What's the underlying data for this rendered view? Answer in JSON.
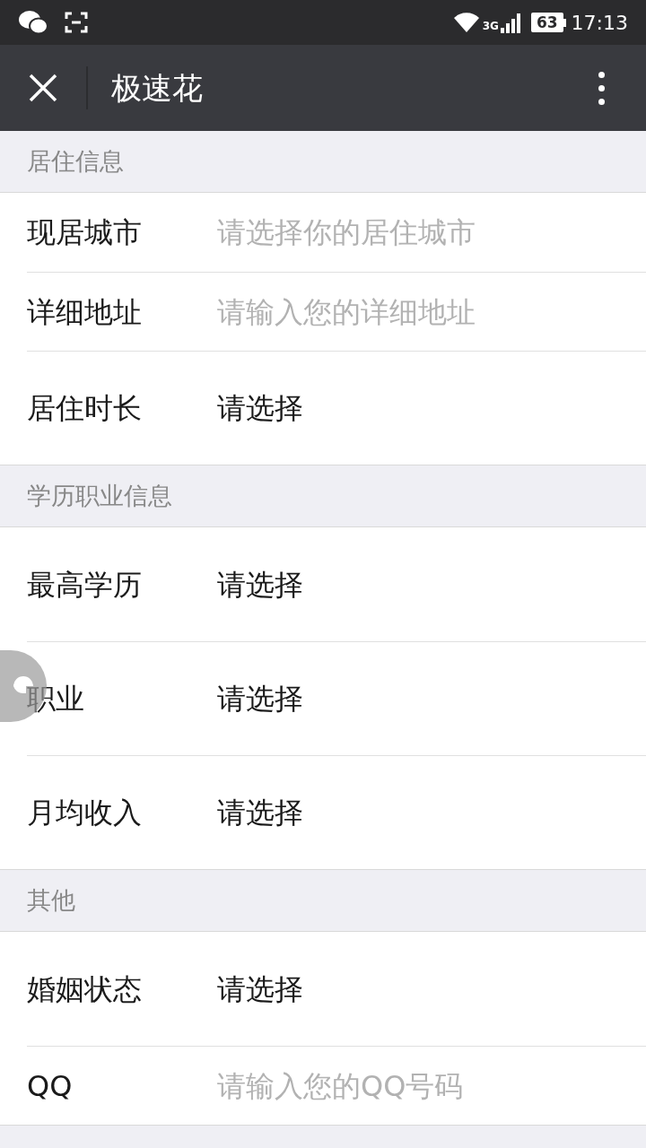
{
  "status_bar": {
    "network": "3G",
    "battery": "63",
    "time": "17:13"
  },
  "nav": {
    "title": "极速花"
  },
  "sections": [
    {
      "title": "居住信息",
      "rows": [
        {
          "label": "现居城市",
          "placeholder": "请选择你的居住城市"
        },
        {
          "label": "详细地址",
          "placeholder": "请输入您的详细地址"
        },
        {
          "label": "居住时长",
          "value": "请选择"
        }
      ]
    },
    {
      "title": "学历职业信息",
      "rows": [
        {
          "label": "最高学历",
          "value": "请选择"
        },
        {
          "label": "职业",
          "value": "请选择"
        },
        {
          "label": "月均收入",
          "value": "请选择"
        }
      ]
    },
    {
      "title": "其他",
      "rows": [
        {
          "label": "婚姻状态",
          "value": "请选择"
        },
        {
          "label": "QQ",
          "placeholder": "请输入您的QQ号码"
        }
      ]
    }
  ]
}
